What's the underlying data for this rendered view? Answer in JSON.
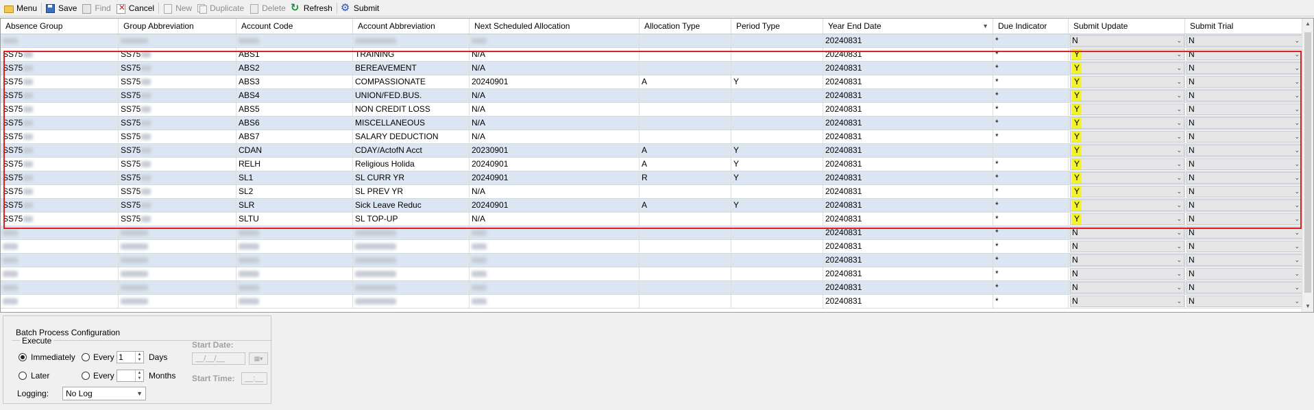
{
  "toolbar": {
    "items": [
      {
        "label": "Menu",
        "icon": "folder-icon",
        "disabled": false
      },
      {
        "label": "Save",
        "icon": "save-icon",
        "disabled": false
      },
      {
        "label": "Find",
        "icon": "find-icon",
        "disabled": true
      },
      {
        "label": "Cancel",
        "icon": "cancel-icon",
        "disabled": false
      },
      {
        "label": "New",
        "icon": "new-icon",
        "disabled": true
      },
      {
        "label": "Duplicate",
        "icon": "duplicate-icon",
        "disabled": true
      },
      {
        "label": "Delete",
        "icon": "delete-icon",
        "disabled": true
      },
      {
        "label": "Refresh",
        "icon": "refresh-icon",
        "disabled": false
      },
      {
        "label": "Submit",
        "icon": "submit-icon",
        "disabled": false
      }
    ]
  },
  "grid": {
    "columns": [
      "Absence Group",
      "Group Abbreviation",
      "Account Code",
      "Account Abbreviation",
      "Next Scheduled Allocation",
      "Allocation Type",
      "Period Type",
      "Year End Date",
      "Due Indicator",
      "Submit Update",
      "Submit Trial"
    ],
    "sorted_column": "Year End Date",
    "rows": [
      {
        "group": "",
        "group_abbr": "",
        "code": "",
        "abbr": "",
        "next": "",
        "alloc": "",
        "period": "",
        "year_end": "20240831",
        "due": "*",
        "update": "N",
        "trial": "N",
        "masked": true
      },
      {
        "group": "SS75",
        "group_abbr": "SS75",
        "code": "ABS1",
        "abbr": "TRAINING",
        "next": "N/A",
        "alloc": "",
        "period": "",
        "year_end": "20240831",
        "due": "*",
        "update": "Y",
        "trial": "N",
        "masked": false
      },
      {
        "group": "SS75",
        "group_abbr": "SS75",
        "code": "ABS2",
        "abbr": "BEREAVEMENT",
        "next": "N/A",
        "alloc": "",
        "period": "",
        "year_end": "20240831",
        "due": "*",
        "update": "Y",
        "trial": "N",
        "masked": false
      },
      {
        "group": "SS75",
        "group_abbr": "SS75",
        "code": "ABS3",
        "abbr": "COMPASSIONATE",
        "next": "20240901",
        "alloc": "A",
        "period": "Y",
        "year_end": "20240831",
        "due": "*",
        "update": "Y",
        "trial": "N",
        "masked": false
      },
      {
        "group": "SS75",
        "group_abbr": "SS75",
        "code": "ABS4",
        "abbr": "UNION/FED.BUS.",
        "next": "N/A",
        "alloc": "",
        "period": "",
        "year_end": "20240831",
        "due": "*",
        "update": "Y",
        "trial": "N",
        "masked": false
      },
      {
        "group": "SS75",
        "group_abbr": "SS75",
        "code": "ABS5",
        "abbr": "NON CREDIT LOSS",
        "next": "N/A",
        "alloc": "",
        "period": "",
        "year_end": "20240831",
        "due": "*",
        "update": "Y",
        "trial": "N",
        "masked": false
      },
      {
        "group": "SS75",
        "group_abbr": "SS75",
        "code": "ABS6",
        "abbr": "MISCELLANEOUS",
        "next": "N/A",
        "alloc": "",
        "period": "",
        "year_end": "20240831",
        "due": "*",
        "update": "Y",
        "trial": "N",
        "masked": false
      },
      {
        "group": "SS75",
        "group_abbr": "SS75",
        "code": "ABS7",
        "abbr": "SALARY DEDUCTION",
        "next": "N/A",
        "alloc": "",
        "period": "",
        "year_end": "20240831",
        "due": "*",
        "update": "Y",
        "trial": "N",
        "masked": false
      },
      {
        "group": "SS75",
        "group_abbr": "SS75",
        "code": "CDAN",
        "abbr": "CDAY/ActofN Acct",
        "next": "20230901",
        "alloc": "A",
        "period": "Y",
        "year_end": "20240831",
        "due": "",
        "update": "Y",
        "trial": "N",
        "masked": false
      },
      {
        "group": "SS75",
        "group_abbr": "SS75",
        "code": "RELH",
        "abbr": "Religious Holida",
        "next": "20240901",
        "alloc": "A",
        "period": "Y",
        "year_end": "20240831",
        "due": "*",
        "update": "Y",
        "trial": "N",
        "masked": false
      },
      {
        "group": "SS75",
        "group_abbr": "SS75",
        "code": "SL1",
        "abbr": "SL CURR YR",
        "next": "20240901",
        "alloc": "R",
        "period": "Y",
        "year_end": "20240831",
        "due": "*",
        "update": "Y",
        "trial": "N",
        "masked": false
      },
      {
        "group": "SS75",
        "group_abbr": "SS75",
        "code": "SL2",
        "abbr": "SL PREV YR",
        "next": "N/A",
        "alloc": "",
        "period": "",
        "year_end": "20240831",
        "due": "*",
        "update": "Y",
        "trial": "N",
        "masked": false
      },
      {
        "group": "SS75",
        "group_abbr": "SS75",
        "code": "SLR",
        "abbr": "Sick Leave Reduc",
        "next": "20240901",
        "alloc": "A",
        "period": "Y",
        "year_end": "20240831",
        "due": "*",
        "update": "Y",
        "trial": "N",
        "masked": false
      },
      {
        "group": "SS75",
        "group_abbr": "SS75",
        "code": "SLTU",
        "abbr": "SL TOP-UP",
        "next": "N/A",
        "alloc": "",
        "period": "",
        "year_end": "20240831",
        "due": "*",
        "update": "Y",
        "trial": "N",
        "masked": false
      },
      {
        "group": "",
        "group_abbr": "",
        "code": "",
        "abbr": "",
        "next": "",
        "alloc": "",
        "period": "",
        "year_end": "20240831",
        "due": "*",
        "update": "N",
        "trial": "N",
        "masked": true
      },
      {
        "group": "",
        "group_abbr": "",
        "code": "",
        "abbr": "",
        "next": "",
        "alloc": "",
        "period": "",
        "year_end": "20240831",
        "due": "*",
        "update": "N",
        "trial": "N",
        "masked": true
      },
      {
        "group": "",
        "group_abbr": "",
        "code": "",
        "abbr": "",
        "next": "",
        "alloc": "",
        "period": "",
        "year_end": "20240831",
        "due": "*",
        "update": "N",
        "trial": "N",
        "masked": true
      },
      {
        "group": "",
        "group_abbr": "",
        "code": "",
        "abbr": "",
        "next": "",
        "alloc": "",
        "period": "",
        "year_end": "20240831",
        "due": "*",
        "update": "N",
        "trial": "N",
        "masked": true
      },
      {
        "group": "",
        "group_abbr": "",
        "code": "",
        "abbr": "",
        "next": "",
        "alloc": "",
        "period": "",
        "year_end": "20240831",
        "due": "*",
        "update": "N",
        "trial": "N",
        "masked": true
      },
      {
        "group": "",
        "group_abbr": "",
        "code": "",
        "abbr": "",
        "next": "",
        "alloc": "",
        "period": "",
        "year_end": "20240831",
        "due": "*",
        "update": "N",
        "trial": "N",
        "masked": true
      }
    ]
  },
  "batch": {
    "title": "Batch Process Configuration",
    "execute_label": "Execute",
    "immediately_label": "Immediately",
    "later_label": "Later",
    "every_label": "Every",
    "days_value": "1",
    "days_label": "Days",
    "months_value": "",
    "months_label": "Months",
    "start_date_label": "Start Date:",
    "start_date_placeholder": "__/__/__",
    "start_time_label": "Start Time:",
    "start_time_placeholder": "__:__",
    "logging_label": "Logging:",
    "logging_value": "No Log",
    "execute_mode": "Immediately"
  },
  "colors": {
    "row_alt": "#dbe6f2",
    "highlight_yellow": "#f3f32a",
    "annotation_red": "#e02020"
  }
}
